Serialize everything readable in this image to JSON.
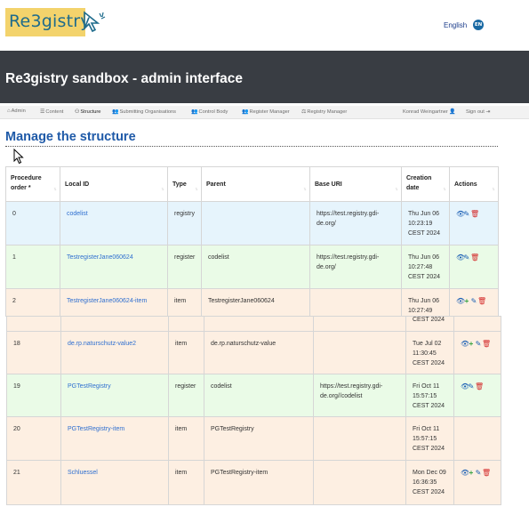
{
  "header": {
    "logo_text": "Re3gistry",
    "language": "English",
    "language_badge": "EN"
  },
  "banner": {
    "title": "Re3gistry sandbox - admin interface"
  },
  "nav": {
    "items": [
      {
        "icon": "home-icon",
        "glyph": "⌂",
        "label": "Admin"
      },
      {
        "icon": "list-icon",
        "glyph": "☰",
        "label": "Content"
      },
      {
        "icon": "sitemap-icon",
        "glyph": "⚇",
        "label": "Structure"
      },
      {
        "icon": "users-icon",
        "glyph": "👥",
        "label": "Submitting Organisations"
      },
      {
        "icon": "users-icon",
        "glyph": "👥",
        "label": "Control Body"
      },
      {
        "icon": "users-icon",
        "glyph": "👥",
        "label": "Register Manager"
      },
      {
        "icon": "gavel-icon",
        "glyph": "⚖",
        "label": "Registry Manager"
      }
    ],
    "user": "Konrad Weingartner",
    "signout": "Sign out"
  },
  "page": {
    "title": "Manage the structure"
  },
  "table": {
    "headers": [
      "Procedure order *",
      "Local ID",
      "Type",
      "Parent",
      "Base URI",
      "Creation date",
      "Actions"
    ],
    "rows_top": [
      {
        "order": "0",
        "local_id": "codelist",
        "type": "registry",
        "parent": "",
        "base_uri": "https://test.registry.gdi-de.org/",
        "date": "Thu Jun 06 10:23:19 CEST 2024",
        "actions": "view,edit,delete"
      },
      {
        "order": "1",
        "local_id": "TestregisterJane060624",
        "type": "register",
        "parent": "codelist",
        "base_uri": "https://test.registry.gdi-de.org/",
        "date": "Thu Jun 06 10:27:48 CEST 2024",
        "actions": "view,edit,delete"
      },
      {
        "order": "2",
        "local_id": "TestregisterJane060624-item",
        "type": "item",
        "parent": "TestregisterJane060624",
        "base_uri": "",
        "date": "Thu Jun 06 10:27:49",
        "actions": "view,add,edit,delete"
      }
    ],
    "partial_text": "CEST 2024",
    "rows_bottom": [
      {
        "order": "18",
        "local_id": "de.rp.naturschutz-value2",
        "type": "item",
        "parent": "de.rp.naturschutz-value",
        "base_uri": "",
        "date": "Tue Jul 02 11:30:45 CEST 2024",
        "actions": "view,add,edit,delete"
      },
      {
        "order": "19",
        "local_id": "PGTestRegistry",
        "type": "register",
        "parent": "codelist",
        "base_uri": "https://test.registry.gdi-de.org//codelist",
        "date": "Fri Oct 11 15:57:15 CEST 2024",
        "actions": "view,edit,delete"
      },
      {
        "order": "20",
        "local_id": "PGTestRegistry-item",
        "type": "item",
        "parent": "PGTestRegistry",
        "base_uri": "",
        "date": "Fri Oct 11 15:57:15 CEST 2024",
        "actions": "view,add,edit,delete"
      },
      {
        "order": "21",
        "local_id": "Schluessel",
        "type": "item",
        "parent": "PGTestRegistry-item",
        "base_uri": "",
        "date": "Mon Dec 09 16:36:35 CEST 2024",
        "actions": "view,add,edit,delete"
      }
    ]
  },
  "colors": {
    "banner": "#393d43",
    "title": "#1f5aa8",
    "link": "#2f6fd0",
    "row_registry": "#e6f4fc",
    "row_register": "#eafbe7",
    "row_item": "#fdefe2",
    "logo_bg": "#f3d36c"
  }
}
